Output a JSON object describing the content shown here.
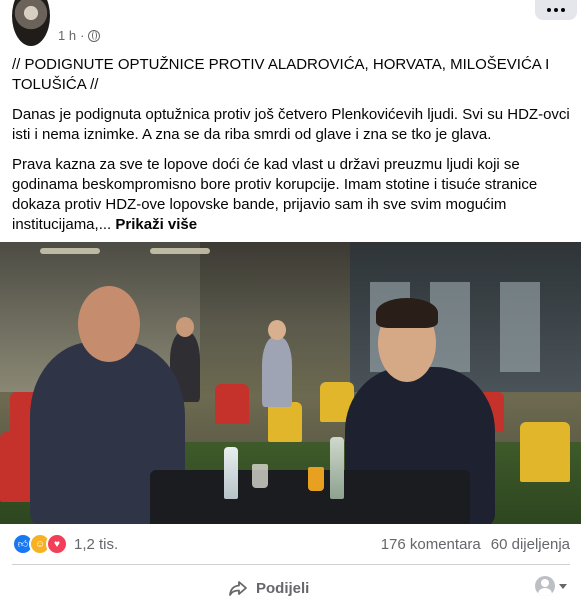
{
  "post": {
    "time": "1 h",
    "paragraphs": [
      "// PODIGNUTE OPTUŽNICE PROTIV ALADROVIĆA, HORVATA, MILOŠEVIĆA I TOLUŠIĆA //",
      "Danas je podignuta optužnica protiv još četvero Plenkovićevih ljudi. Svi su HDZ-ovci isti i nema iznimke. A zna se da riba smrdi od glave i zna se tko je glava.",
      "Prava kazna za sve te lopove doći će kad vlast u državi preuzmu ljudi koji se godinama beskompromisno bore protiv korupcije. Imam stotine i tisuće stranice dokaza protiv HDZ-ove lopovske bande, prijavio sam ih sve svim mogućim institucijama,..."
    ],
    "see_more": "Prikaži više"
  },
  "stats": {
    "reactions_count": "1,2 tis.",
    "comments": "176 komentara",
    "shares": "60 dijeljenja"
  },
  "actions": {
    "share_label": "Podijeli"
  },
  "colors": {
    "like": "#1877f2",
    "care": "#f7b125",
    "love": "#f33e58",
    "secondary_text": "#65676b"
  }
}
